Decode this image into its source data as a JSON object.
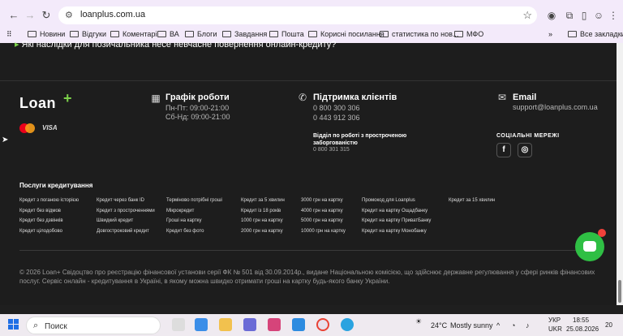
{
  "browser": {
    "url": "loanplus.com.ua",
    "bookmarks": [
      "Новини",
      "Відгуки",
      "Коментарі",
      "ВА",
      "Блоги",
      "Завдання",
      "Пошта",
      "Корисні посилання",
      "статистика по нов...",
      "МФО"
    ],
    "all_bookmarks": "Все закладки"
  },
  "page": {
    "top_question": "Які наслідки для позичальника несе невчасне повернення онлайн-кредиту?",
    "logo_text": "Loan",
    "schedule": {
      "title": "Графік роботи",
      "line1": "Пн-Пт: 09:00-21:00",
      "line2": "Сб-Нд: 09:00-21:00"
    },
    "support": {
      "title": "Підтримка клієнтів",
      "phone1": "0 800 300 306",
      "phone2": "0 443 912 306",
      "debt_title": "Відділ по роботі з простроченою заборгованістю",
      "debt_phone": "0 800 301 315"
    },
    "email": {
      "title": "Email",
      "address": "support@loanplus.com.ua"
    },
    "social_title": "СОЦІАЛЬНІ МЕРЕЖІ",
    "payment": {
      "visa": "VISA"
    },
    "services_title": "Послуги кредитування",
    "services": [
      [
        "Кредит з поганою історією",
        "Кредит без відмов",
        "Кредит без дзвінків",
        "Кредит цілодобово"
      ],
      [
        "Кредит через банк ID",
        "Кредит з простроченнями",
        "Швидкий кредит",
        "Довгостроковий кредит"
      ],
      [
        "Терміново потрібні гроші",
        "Мікрокредит",
        "Гроші на картку",
        "Кредит без фото"
      ],
      [
        "Кредит за 5 хвилин",
        "Кредит із 18 років",
        "1000 грн на картку",
        "2000 грн на картку"
      ],
      [
        "3000 грн на картку",
        "4000 грн на картку",
        "5000 грн на картку",
        "10000 грн на картку"
      ],
      [
        "Промокод для Loanplus",
        "Кредит на картку Ощадбанку",
        "Кредит на картку ПриватБанку",
        "Кредит на картку Монобанку"
      ],
      [
        "Кредит за 15 хвилин"
      ]
    ],
    "copyright": "© 2026 Loan+ Свідоцтво про реєстрацію фінансової установи серії ФК № 501 від 30.09.2014р., видане Національною комісією, що здійснює державне регулювання у сфері ринків фінансових послуг. Сервіс онлайн - кредитування в Україні, в якому можна швидко отримати гроші на картку будь-якого банку України."
  },
  "taskbar": {
    "search": "Поиск",
    "weather": "24°C",
    "weather_desc": "Mostly sunny",
    "lang1": "УКР",
    "lang2": "UKR",
    "time": "18:55",
    "date": "25.08.2026",
    "notif": "20"
  },
  "colors": {
    "accent": "#7cd14a",
    "chat": "#2fbf44",
    "bg": "#1d1d1d"
  }
}
